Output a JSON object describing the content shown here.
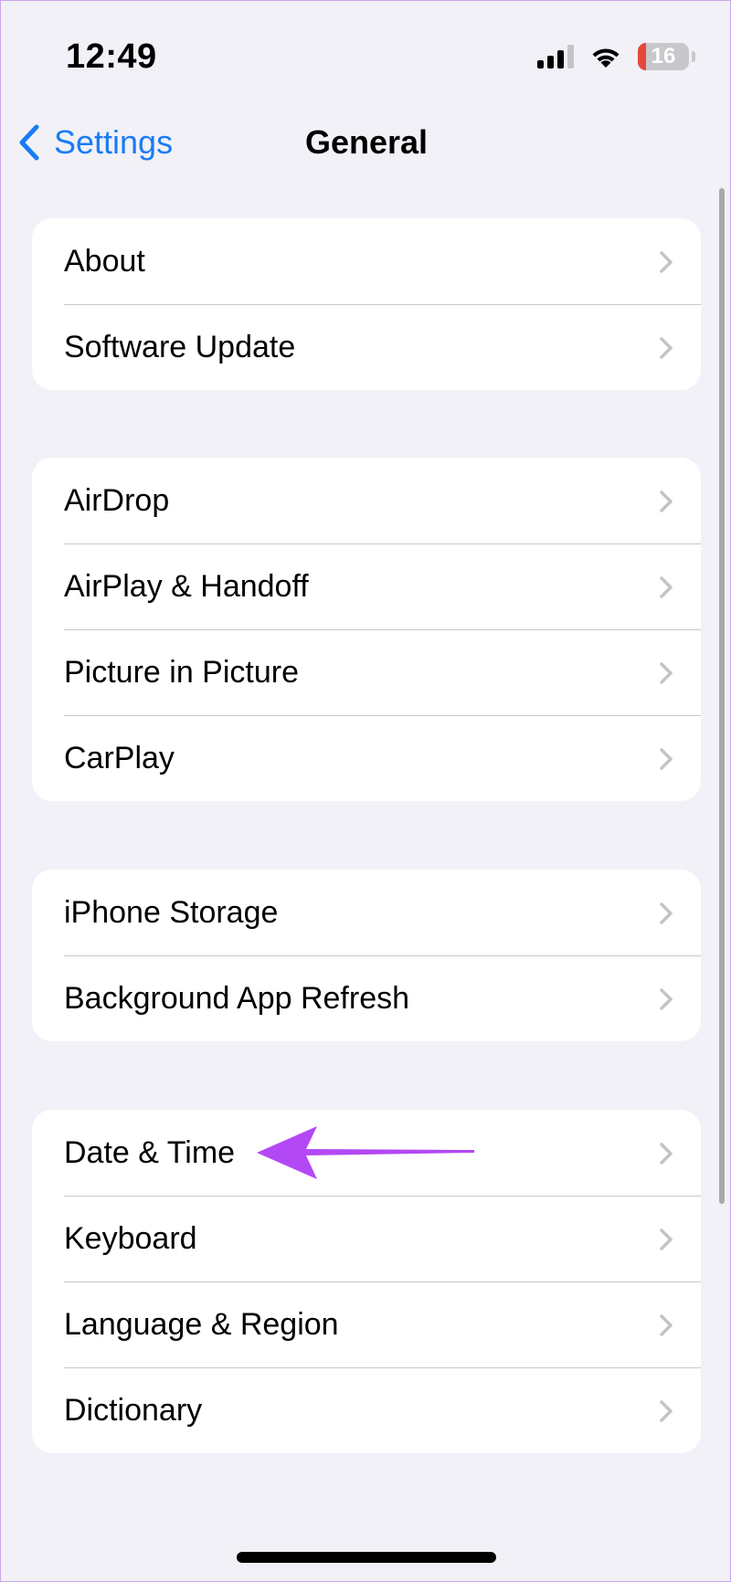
{
  "status_bar": {
    "time": "12:49",
    "battery_level": "16",
    "icons": [
      "cellular-signal-icon",
      "wifi-icon",
      "battery-icon"
    ]
  },
  "nav": {
    "back_label": "Settings",
    "title": "General"
  },
  "groups": [
    {
      "items": [
        {
          "label": "About"
        },
        {
          "label": "Software Update"
        }
      ]
    },
    {
      "items": [
        {
          "label": "AirDrop"
        },
        {
          "label": "AirPlay & Handoff"
        },
        {
          "label": "Picture in Picture"
        },
        {
          "label": "CarPlay"
        }
      ]
    },
    {
      "items": [
        {
          "label": "iPhone Storage"
        },
        {
          "label": "Background App Refresh"
        }
      ]
    },
    {
      "items": [
        {
          "label": "Date & Time"
        },
        {
          "label": "Keyboard"
        },
        {
          "label": "Language & Region"
        },
        {
          "label": "Dictionary"
        }
      ]
    }
  ],
  "colors": {
    "accent": "#1a7cf5",
    "background": "#f2f1f7",
    "annotation_arrow": "#b348f5",
    "battery_low": "#e5483a"
  }
}
